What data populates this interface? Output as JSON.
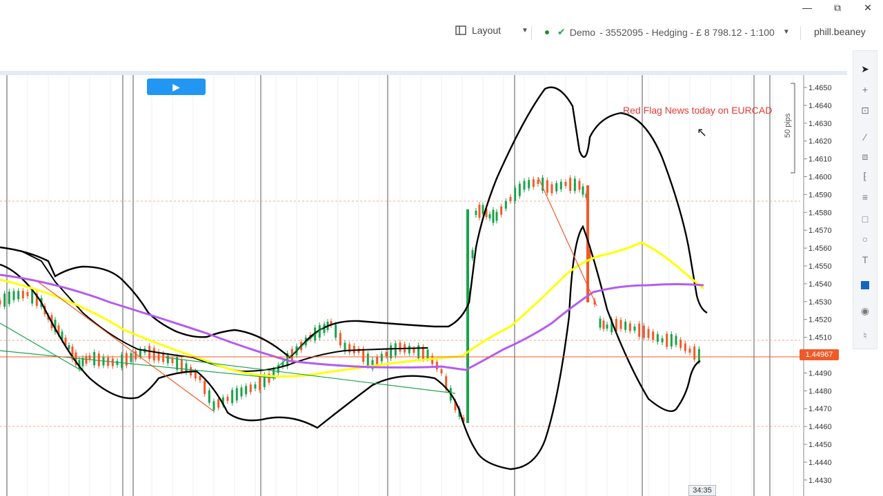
{
  "window": {
    "minimize_icon": "minimize-icon",
    "restore_icon": "restore-icon",
    "close_icon": "close-icon"
  },
  "toolbar": {
    "layout_label": "Layout",
    "account_mode": "Demo",
    "account_details": "- 3552095 - Hedging - £ 8 798.12 - 1:100",
    "username": "phill.beaney"
  },
  "chart": {
    "annotation": "Red Flag News today on EURCAD",
    "range_label": "50 pips",
    "current_price": "1.44967",
    "countdown": "34:35",
    "price_ticks": [
      "1.4650",
      "1.4640",
      "1.4630",
      "1.4620",
      "1.4610",
      "1.4600",
      "1.4590",
      "1.4580",
      "1.4570",
      "1.4560",
      "1.4550",
      "1.4540",
      "1.4530",
      "1.4520",
      "1.4510",
      "1.4500",
      "1.4490",
      "1.4480",
      "1.4470",
      "1.4460",
      "1.4450",
      "1.4440",
      "1.4430"
    ],
    "colors": {
      "up": "#1aa34a",
      "down": "#f05a28",
      "ma_yellow": "#ffff00",
      "ma_purple": "#b35cf0",
      "bands": "#000000",
      "annotation": "#e53935",
      "play_button": "#2196f3"
    }
  },
  "right_tools": [
    "cursor-icon",
    "crosshair-icon",
    "measure-icon",
    "line-icon",
    "pitchfork-icon",
    "channel-icon",
    "fibonacci-icon",
    "rectangle-icon",
    "ellipse-icon",
    "text-icon",
    "color-swatch-icon",
    "screenshot-icon",
    "alert-bell-icon"
  ]
}
